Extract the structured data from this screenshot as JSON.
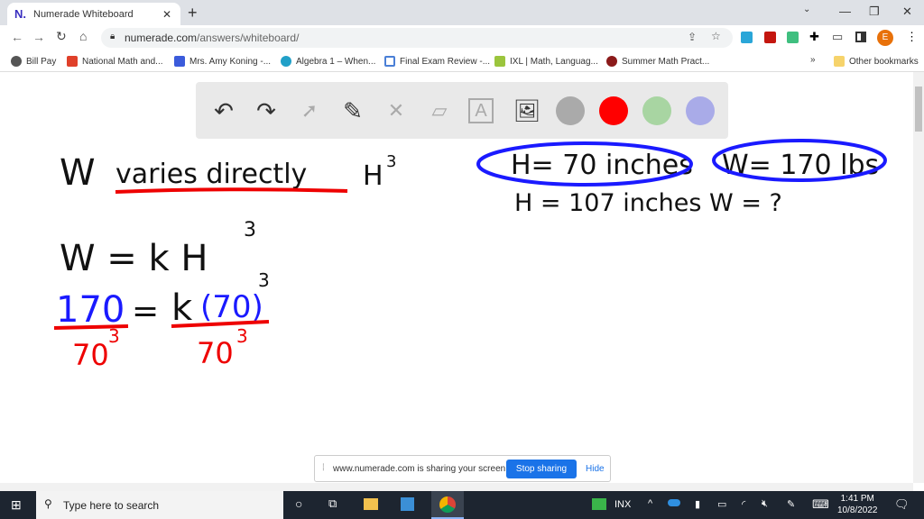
{
  "browser": {
    "tab_title": "Numerade Whiteboard",
    "tab_logo": "N.",
    "url_domain": "numerade.com",
    "url_path": "/answers/whiteboard/",
    "profile_initial": "E"
  },
  "bookmarks": [
    {
      "label": "Bill Pay",
      "color": "#555"
    },
    {
      "label": "National Math and...",
      "color": "#e0402a"
    },
    {
      "label": "Mrs. Amy Koning -...",
      "color": "#3b5bdb"
    },
    {
      "label": "Algebra 1 – When...",
      "color": "#21a0c8"
    },
    {
      "label": "Final Exam Review -...",
      "color": "#4a7fd6"
    },
    {
      "label": "IXL | Math, Languag...",
      "color": "#9bc53d"
    },
    {
      "label": "Summer Math Pract...",
      "color": "#8b1a1a"
    }
  ],
  "other_bookmarks": "Other bookmarks",
  "whiteboard": {
    "tools": [
      "undo-icon",
      "redo-icon",
      "pointer-icon",
      "pen-icon",
      "tools-icon",
      "eraser-icon",
      "text-icon",
      "image-icon"
    ],
    "colors": [
      "#aaaaaa",
      "#ff0000",
      "#a8d5a2",
      "#a9abe8"
    ],
    "handwriting": {
      "line1_w": "W",
      "line1_varies": "varies directly",
      "line1_h": "H",
      "exp": "3",
      "line2": "W = k H",
      "num": "170",
      "eq": "=",
      "k": "k",
      "paren": "(70)",
      "den": "70",
      "given1": "H= 70 inches",
      "given2": "W= 170 lbs",
      "given3": "H = 107 inches  W = ?"
    }
  },
  "share_bar": {
    "message": "www.numerade.com is sharing your screen.",
    "stop": "Stop sharing",
    "hide": "Hide"
  },
  "taskbar": {
    "search_placeholder": "Type here to search",
    "ticker": "INX",
    "time": "1:41 PM",
    "date": "10/8/2022"
  }
}
